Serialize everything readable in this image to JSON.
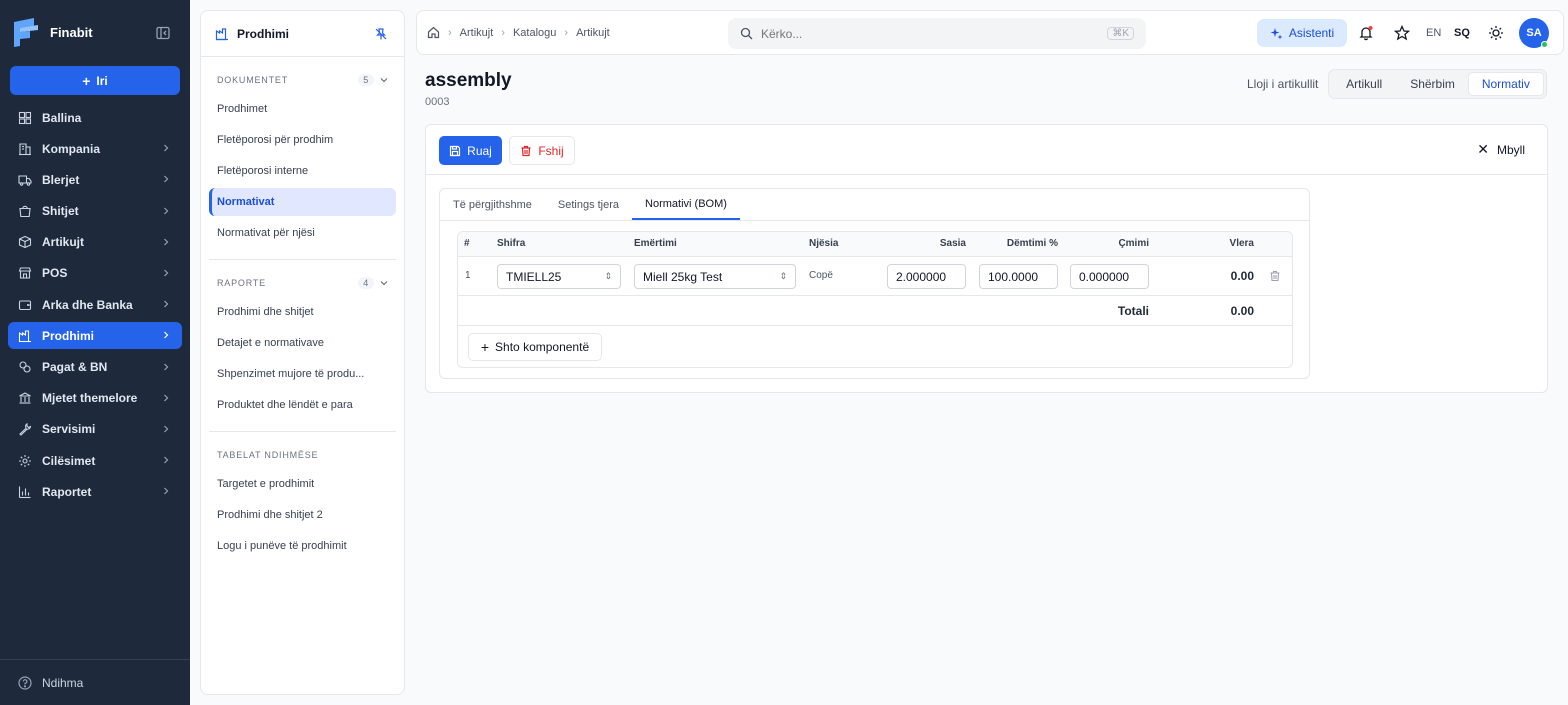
{
  "sidebar": {
    "brand": "Finabit",
    "new_button": "Iri",
    "items": [
      {
        "label": "Ballina",
        "icon": "dashboard-icon",
        "has_children": false
      },
      {
        "label": "Kompania",
        "icon": "building-icon",
        "has_children": true
      },
      {
        "label": "Blerjet",
        "icon": "truck-icon",
        "has_children": true
      },
      {
        "label": "Shitjet",
        "icon": "shopping-bag-icon",
        "has_children": true
      },
      {
        "label": "Artikujt",
        "icon": "box-icon",
        "has_children": true
      },
      {
        "label": "POS",
        "icon": "store-icon",
        "has_children": true
      },
      {
        "label": "Arka dhe Banka",
        "icon": "wallet-icon",
        "has_children": true
      },
      {
        "label": "Prodhimi",
        "icon": "factory-icon",
        "has_children": true,
        "active": true
      },
      {
        "label": "Pagat & BN",
        "icon": "coins-icon",
        "has_children": true
      },
      {
        "label": "Mjetet themelore",
        "icon": "bank-icon",
        "has_children": true
      },
      {
        "label": "Servisimi",
        "icon": "wrench-icon",
        "has_children": true
      },
      {
        "label": "Cilësimet",
        "icon": "gear-icon",
        "has_children": true
      },
      {
        "label": "Raportet",
        "icon": "chart-icon",
        "has_children": true
      }
    ],
    "footer": "Ndihma"
  },
  "subpanel": {
    "title": "Prodhimi",
    "sections": [
      {
        "title": "DOKUMENTET",
        "count": "5",
        "items": [
          "Prodhimet",
          "Fletëporosi për prodhim",
          "Fletëporosi interne",
          "Normativat",
          "Normativat për njësi"
        ],
        "active_index": 3
      },
      {
        "title": "RAPORTE",
        "count": "4",
        "items": [
          "Prodhimi dhe shitjet",
          "Detajet e normativave",
          "Shpenzimet mujore të produ...",
          "Produktet dhe lëndët e para"
        ]
      },
      {
        "title": "TABELAT NDIHMËSE",
        "items": [
          "Targetet e prodhimit",
          "Prodhimi dhe shitjet 2",
          "Logu i punëve të prodhimit"
        ]
      }
    ]
  },
  "topbar": {
    "breadcrumbs": [
      "Artikujt",
      "Katalogu",
      "Artikujt"
    ],
    "search_placeholder": "Kërko...",
    "search_shortcut": "⌘K",
    "assistant": "Asistenti",
    "lang_en": "EN",
    "lang_sq": "SQ",
    "avatar": "SA",
    "colors": {
      "accent": "#2563eb",
      "notification": "#ef4444",
      "online": "#22c55e"
    }
  },
  "page": {
    "title": "assembly",
    "code": "0003",
    "type_label": "Lloji i artikullit",
    "types": [
      "Artikull",
      "Shërbim",
      "Normativ"
    ],
    "active_type": "Normativ"
  },
  "card": {
    "save": "Ruaj",
    "delete": "Fshij",
    "close": "Mbyll",
    "tabs": [
      "Të përgjithshme",
      "Setings tjera",
      "Normativi (BOM)"
    ],
    "active_tab": "Normativi (BOM)"
  },
  "bom": {
    "headers": {
      "num": "#",
      "code": "Shifra",
      "name": "Emërtimi",
      "unit": "Njësia",
      "qty": "Sasia",
      "loss": "Dëmtimi %",
      "price": "Çmimi",
      "value": "Vlera"
    },
    "rows": [
      {
        "num": "1",
        "code": "TMIELL25",
        "name": "Miell 25kg Test",
        "unit": "Copë",
        "qty": "2.000000",
        "loss": "100.0000",
        "price": "0.000000",
        "value": "0.00"
      }
    ],
    "total_label": "Totali",
    "total_value": "0.00",
    "add_component": "Shto komponentë"
  }
}
